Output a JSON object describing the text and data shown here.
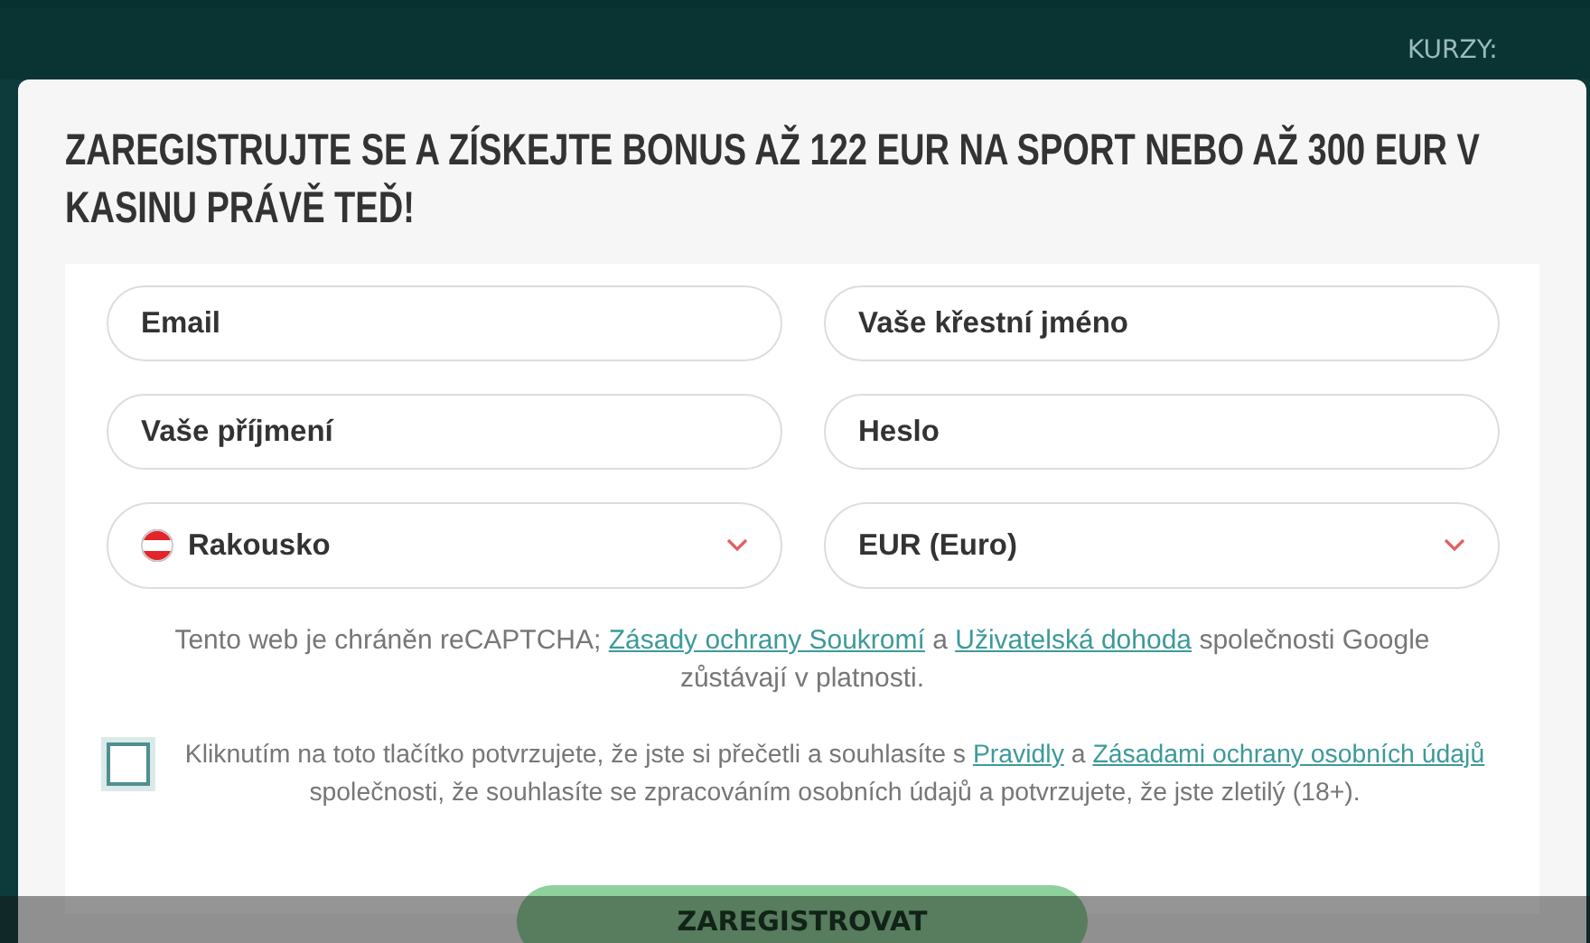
{
  "background": {
    "odds_label": "KURZY:"
  },
  "modal": {
    "title": "ZAREGISTRUJTE SE A ZÍSKEJTE BONUS AŽ 122 EUR NA SPORT NEBO AŽ 300 EUR V KASINU PRÁVĚ TEĎ!",
    "fields": [
      {
        "kind": "input",
        "placeholder": "Email"
      },
      {
        "kind": "input",
        "placeholder": "Vaše křestní jméno"
      },
      {
        "kind": "input",
        "placeholder": "Vaše příjmení"
      },
      {
        "kind": "input",
        "placeholder": "Heslo"
      },
      {
        "kind": "country",
        "value": "Rakousko"
      },
      {
        "kind": "select",
        "value": "EUR (Euro)"
      }
    ],
    "recaptcha_note": [
      {
        "text": "Tento web je chráněn reCAPTCHA; ",
        "link": false
      },
      {
        "text": "Zásady ochrany Soukromí",
        "link": true
      },
      {
        "text": " a ",
        "link": false
      },
      {
        "text": "Uživatelská dohoda",
        "link": true
      },
      {
        "text": " společnosti Google zůstávají v platnosti.",
        "link": false
      }
    ],
    "consent": {
      "checked": false,
      "parts": [
        {
          "text": "Kliknutím na toto tlačítko potvrzujete, že jste si přečetli a souhlasíte s ",
          "link": false
        },
        {
          "text": "Pravidly",
          "link": true
        },
        {
          "text": " a ",
          "link": false
        },
        {
          "text": "Zásadami ochrany osobních údajů",
          "link": true
        },
        {
          "text": " společnosti, že souhlasíte se zpracováním osobních údajů a potvrzujete, že jste zletilý (18+).",
          "link": false
        }
      ]
    },
    "submit": "ZAREGISTROVAT"
  }
}
